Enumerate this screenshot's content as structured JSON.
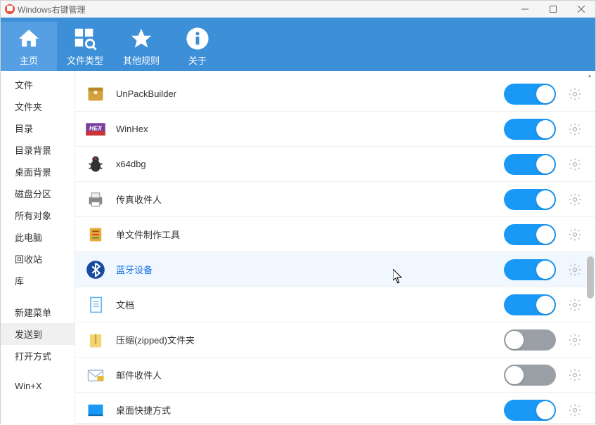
{
  "window": {
    "title": "Windows右键管理"
  },
  "toolbar": {
    "items": [
      {
        "label": "主页",
        "icon": "home",
        "active": true
      },
      {
        "label": "文件类型",
        "icon": "grid-search",
        "active": false
      },
      {
        "label": "其他规则",
        "icon": "star",
        "active": false
      },
      {
        "label": "关于",
        "icon": "info",
        "active": false
      }
    ]
  },
  "sidebar": {
    "groups": [
      [
        {
          "label": "文件",
          "active": false
        },
        {
          "label": "文件夹",
          "active": false
        },
        {
          "label": "目录",
          "active": false
        },
        {
          "label": "目录背景",
          "active": false
        },
        {
          "label": "桌面背景",
          "active": false
        },
        {
          "label": "磁盘分区",
          "active": false
        },
        {
          "label": "所有对象",
          "active": false
        },
        {
          "label": "此电脑",
          "active": false
        },
        {
          "label": "回收站",
          "active": false
        },
        {
          "label": "库",
          "active": false
        }
      ],
      [
        {
          "label": "新建菜单",
          "active": false
        },
        {
          "label": "发送到",
          "active": true
        },
        {
          "label": "打开方式",
          "active": false
        }
      ],
      [
        {
          "label": "Win+X",
          "active": false
        }
      ]
    ]
  },
  "list": {
    "items": [
      {
        "label": "UnPackBuilder",
        "icon": "box",
        "iconColor": "#d4a23c",
        "enabled": true,
        "highlighted": false
      },
      {
        "label": "WinHex",
        "icon": "hex",
        "iconColor": "#7b3fa0",
        "enabled": true,
        "highlighted": false
      },
      {
        "label": "x64dbg",
        "icon": "bug",
        "iconColor": "#333",
        "enabled": true,
        "highlighted": false
      },
      {
        "label": "传真收件人",
        "icon": "fax",
        "iconColor": "#888",
        "enabled": true,
        "highlighted": false
      },
      {
        "label": "单文件制作工具",
        "icon": "tool",
        "iconColor": "#e8a838",
        "enabled": true,
        "highlighted": false
      },
      {
        "label": "蓝牙设备",
        "icon": "bluetooth",
        "iconColor": "#1a4aa0",
        "enabled": true,
        "highlighted": true
      },
      {
        "label": "文档",
        "icon": "doc",
        "iconColor": "#6bb5ec",
        "enabled": true,
        "highlighted": false
      },
      {
        "label": "压缩(zipped)文件夹",
        "icon": "zip",
        "iconColor": "#f4d576",
        "enabled": false,
        "highlighted": false
      },
      {
        "label": "邮件收件人",
        "icon": "mail",
        "iconColor": "#9db9d6",
        "enabled": false,
        "highlighted": false
      },
      {
        "label": "桌面快捷方式",
        "icon": "desktop",
        "iconColor": "#1999f5",
        "enabled": true,
        "highlighted": false
      }
    ]
  }
}
